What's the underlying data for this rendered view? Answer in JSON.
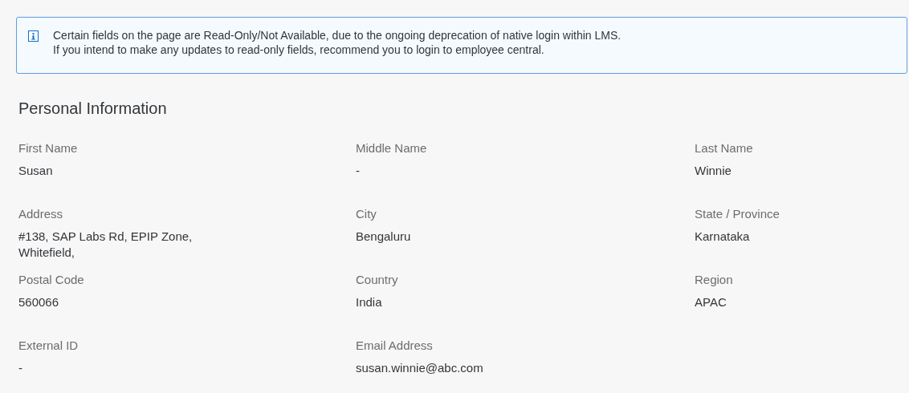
{
  "notice": {
    "lines": [
      "Certain fields on the page are Read-Only/Not Available, due to the ongoing deprecation of native login within LMS.",
      "If you intend to make any updates to read-only fields, recommend you to login to employee central."
    ]
  },
  "section": {
    "title": "Personal Information"
  },
  "fields": [
    {
      "label": "First Name",
      "value": "Susan"
    },
    {
      "label": "Middle Name",
      "value": "-"
    },
    {
      "label": "Last Name",
      "value": "Winnie"
    },
    {
      "label": "Address",
      "value": "#138, SAP Labs Rd, EPIP Zone, Whitefield,"
    },
    {
      "label": "City",
      "value": "Bengaluru"
    },
    {
      "label": "State / Province",
      "value": "Karnataka"
    },
    {
      "label": "Postal Code",
      "value": "560066"
    },
    {
      "label": "Country",
      "value": "India"
    },
    {
      "label": "Region",
      "value": "APAC"
    },
    {
      "label": "External ID",
      "value": "-"
    },
    {
      "label": "Email Address",
      "value": "susan.winnie@abc.com"
    }
  ]
}
